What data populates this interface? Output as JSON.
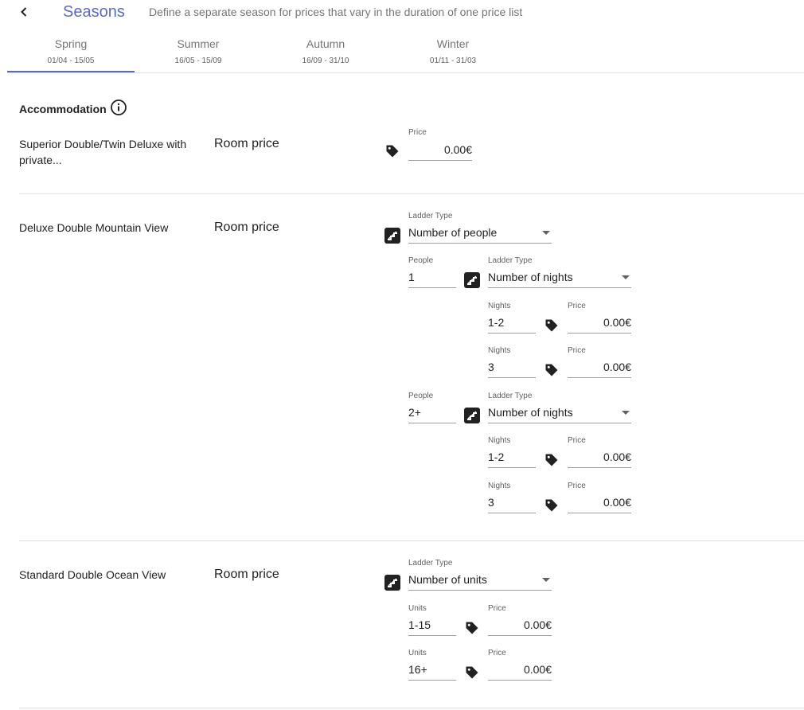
{
  "header": {
    "title": "Seasons",
    "subtitle": "Define a separate season for prices that vary in the duration of one price list"
  },
  "tabs": [
    {
      "label": "Spring",
      "dates": "01/04 - 15/05"
    },
    {
      "label": "Summer",
      "dates": "16/05 - 15/09"
    },
    {
      "label": "Autumn",
      "dates": "16/09 - 31/10"
    },
    {
      "label": "Winter",
      "dates": "01/11 - 31/03"
    }
  ],
  "section": {
    "title": "Accommodation"
  },
  "rooms": [
    {
      "name": "Superior Double/Twin Deluxe with private...",
      "price_label": "Room price",
      "price_field": {
        "label": "Price",
        "value": "0.00€"
      }
    },
    {
      "name": "Deluxe Double Mountain View",
      "price_label": "Room price",
      "ladder": {
        "label": "Ladder Type",
        "value": "Number of people",
        "groups": [
          {
            "people_label": "People",
            "people": "1",
            "ladder_label": "Ladder Type",
            "ladder_value": "Number of nights",
            "rows": [
              {
                "nights_label": "Nights",
                "nights": "1-2",
                "price_label": "Price",
                "price": "0.00€"
              },
              {
                "nights_label": "Nights",
                "nights": "3",
                "price_label": "Price",
                "price": "0.00€"
              }
            ]
          },
          {
            "people_label": "People",
            "people": "2+",
            "ladder_label": "Ladder Type",
            "ladder_value": "Number of nights",
            "rows": [
              {
                "nights_label": "Nights",
                "nights": "1-2",
                "price_label": "Price",
                "price": "0.00€"
              },
              {
                "nights_label": "Nights",
                "nights": "3",
                "price_label": "Price",
                "price": "0.00€"
              }
            ]
          }
        ]
      }
    },
    {
      "name": "Standard Double Ocean View",
      "price_label": "Room price",
      "ladder": {
        "label": "Ladder Type",
        "value": "Number of units",
        "rows": [
          {
            "units_label": "Units",
            "units": "1-15",
            "price_label": "Price",
            "price": "0.00€"
          },
          {
            "units_label": "Units",
            "units": "16+",
            "price_label": "Price",
            "price": "0.00€"
          }
        ]
      }
    }
  ],
  "icons": {
    "back": "chevron-left-icon",
    "info": "info-icon",
    "price": "price-tag-icon",
    "ladder": "ladder-stairs-icon"
  },
  "colors": {
    "accent": "#5c6bc0",
    "text": "#212121",
    "muted": "#757575",
    "divider": "#e0e0e0"
  }
}
